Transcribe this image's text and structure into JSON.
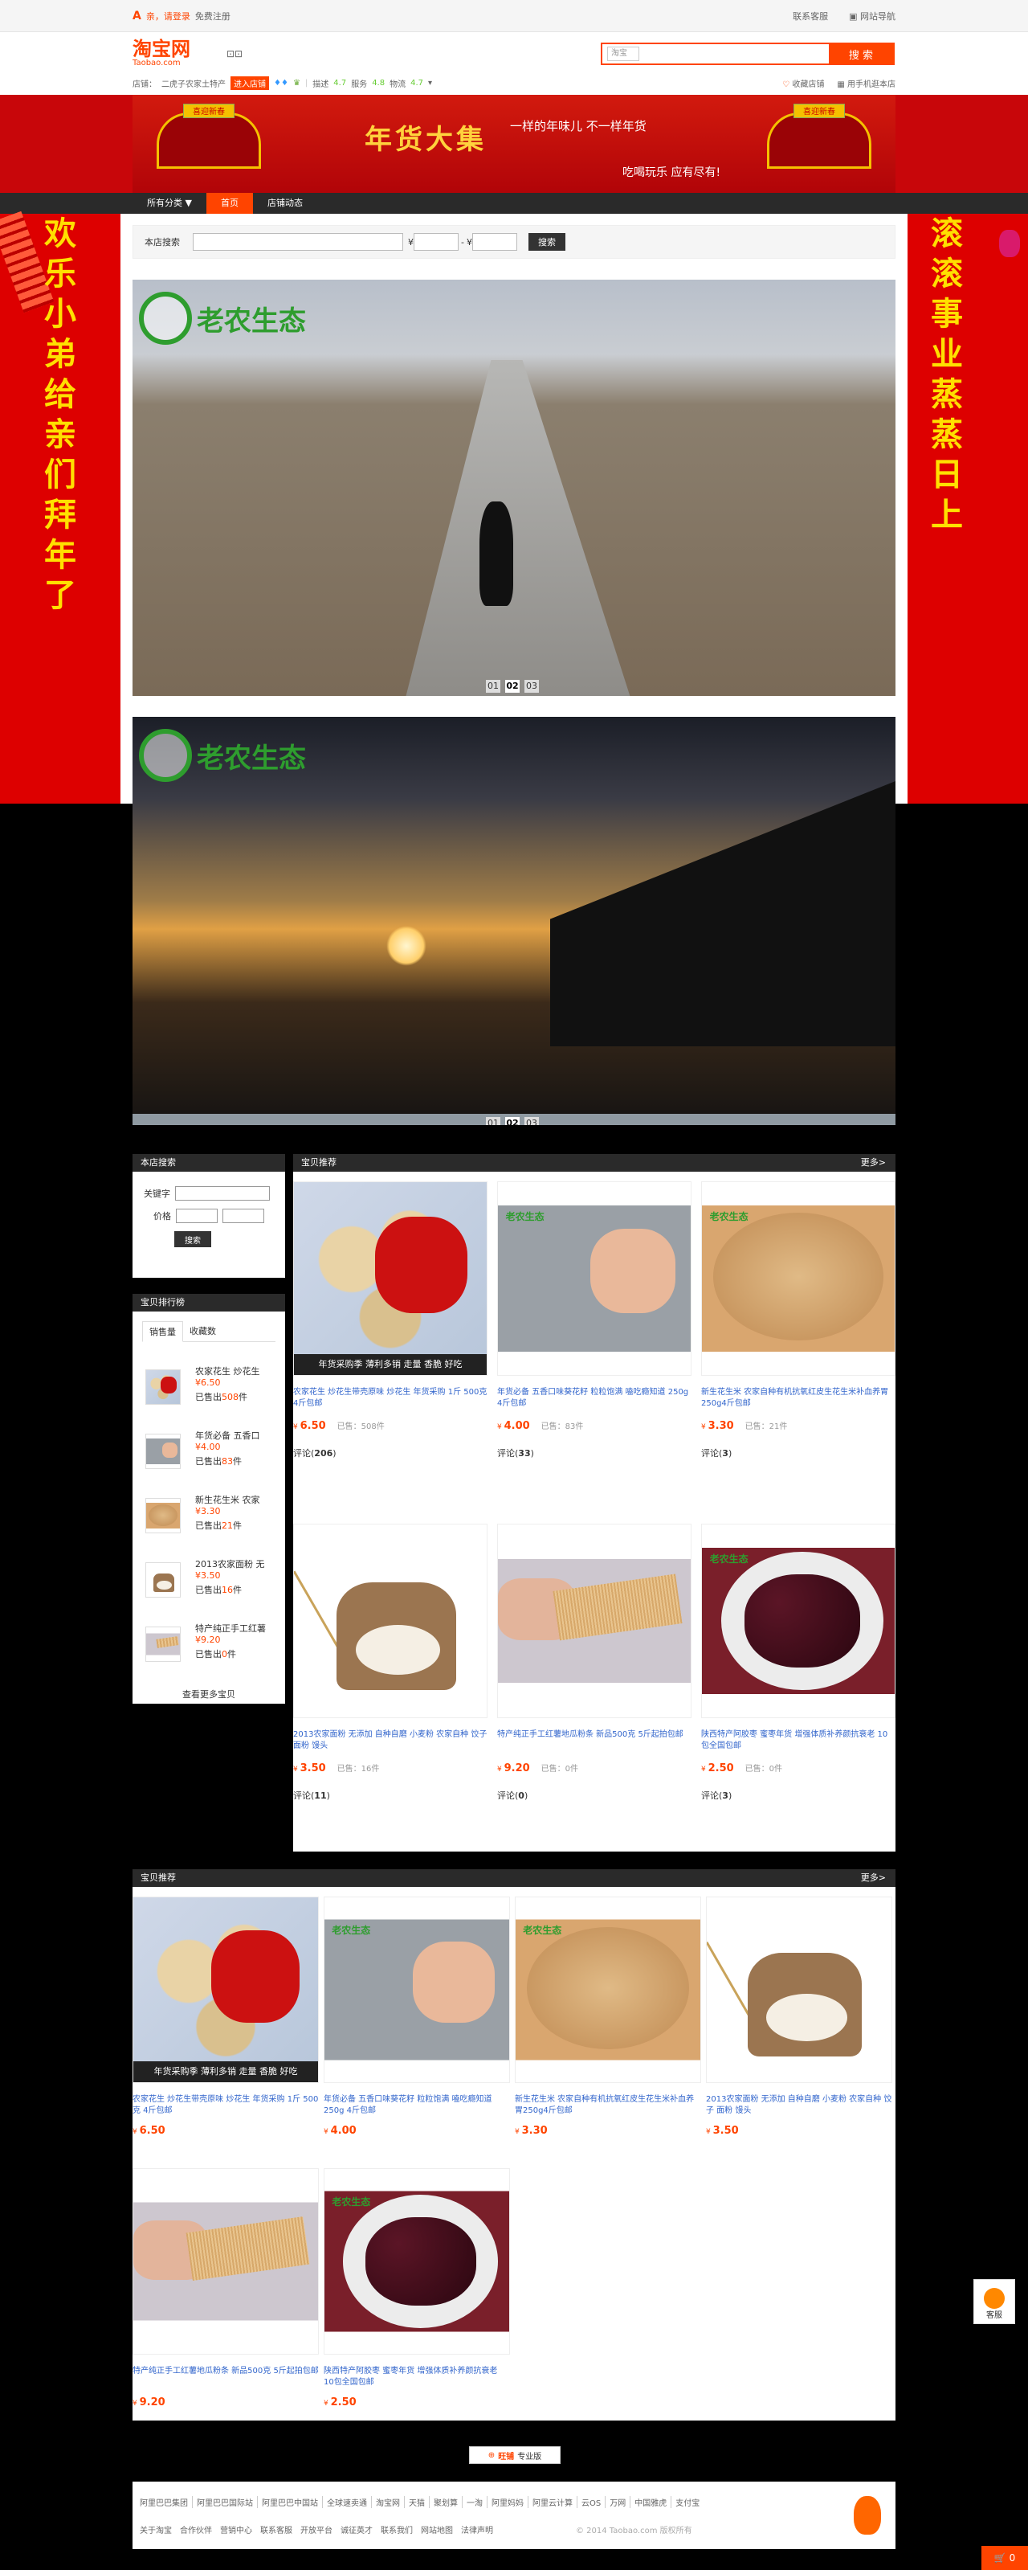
{
  "topbar": {
    "greeting": "亲，请登录",
    "register": "免费注册",
    "contact": "联系客服",
    "sitenav": "网站导航"
  },
  "header": {
    "logo_cn": "淘宝网",
    "logo_en": "Taobao.com",
    "search_scope": "淘宝",
    "search_placeholder": "",
    "search_button": "搜 索",
    "shop_label": "店铺：",
    "shop_name": "二虎子农家土特产",
    "enter_shop": "进入店铺",
    "desc_label": "描述",
    "desc_score": "4.7",
    "service_label": "服务",
    "service_score": "4.8",
    "logistics_label": "物流",
    "logistics_score": "4.7",
    "fav_shop": "收藏店铺",
    "mobile_shop": "用手机逛本店"
  },
  "banner": {
    "title": "年货大集",
    "sub1": "一样的年味儿 不一样年货",
    "sub2": "吃喝玩乐 应有尽有!",
    "gate_left": "喜迎新春",
    "gate_right": "喜迎新春"
  },
  "nav": {
    "all_categories": "所有分类 ▼",
    "home": "首页",
    "shop_news": "店铺动态"
  },
  "side": {
    "left_text": [
      "欢乐小弟给亲们拜年了"
    ],
    "right_text": [
      "滚滚事业蒸蒸日上"
    ]
  },
  "store_search": {
    "label": "本店搜索",
    "currency": "¥",
    "dash": "-",
    "button": "搜索"
  },
  "brand": {
    "name": "老农生态"
  },
  "slider1": {
    "pages": [
      "01",
      "02",
      "03"
    ],
    "current": "02"
  },
  "slider2": {
    "pages": [
      "01",
      "02",
      "03"
    ],
    "current": "02"
  },
  "left_search": {
    "title": "本店搜索",
    "keyword_label": "关键字",
    "price_label": "价格",
    "currency": "¥",
    "button": "搜索"
  },
  "rank": {
    "title": "宝贝排行榜",
    "tab_sales": "销售量",
    "tab_fav": "收藏数",
    "sold_prefix": "已售出",
    "sold_suffix": "件",
    "items": [
      {
        "name": "农家花生 炒花生",
        "price": "¥6.50",
        "sold": "508"
      },
      {
        "name": "年货必备 五香口",
        "price": "¥4.00",
        "sold": "83"
      },
      {
        "name": "新生花生米 农家",
        "price": "¥3.30",
        "sold": "21"
      },
      {
        "name": "2013农家面粉 无",
        "price": "¥3.50",
        "sold": "16"
      },
      {
        "name": "特产纯正手工红薯",
        "price": "¥9.20",
        "sold": "0"
      }
    ],
    "more": "查看更多宝贝"
  },
  "recommend": {
    "title": "宝贝推荐",
    "more": "更多>",
    "sold_label": "已售：",
    "comment_label": "评论",
    "caption": "年货采购季 薄利多销 走量 香脆 好吃",
    "items": [
      {
        "name": "农家花生 炒花生带壳原味 炒花生 年货采购 1斤 500克 4斤包邮",
        "price": "6.50",
        "sold": "508件",
        "comments": "206"
      },
      {
        "name": "年货必备 五香口味葵花籽 粒粒饱满 嗑吃瘾知道 250g 4斤包邮",
        "price": "4.00",
        "sold": "83件",
        "comments": "33"
      },
      {
        "name": "新生花生米 农家自种有机抗氧红皮生花生米补血养胃250g4斤包邮",
        "price": "3.30",
        "sold": "21件",
        "comments": "3"
      },
      {
        "name": "2013农家面粉 无添加 自种自磨 小麦粉 农家自种 饺子 面粉 馒头",
        "price": "3.50",
        "sold": "16件",
        "comments": "11"
      },
      {
        "name": "特产纯正手工红薯地瓜粉条 新品500克 5斤起拍包邮",
        "price": "9.20",
        "sold": "0件",
        "comments": "0"
      },
      {
        "name": "陕西特产阿胶枣 蜜枣年货 增强体质补养颜抗衰老 10包全国包邮",
        "price": "2.50",
        "sold": "0件",
        "comments": "3"
      }
    ]
  },
  "recommend2": {
    "title": "宝贝推荐",
    "more": "更多>",
    "items": [
      {
        "name": "农家花生 炒花生带壳原味 炒花生 年货采购 1斤 500克 4斤包邮",
        "price": "6.50"
      },
      {
        "name": "年货必备 五香口味葵花籽 粒粒饱满 嗑吃瘾知道 250g 4斤包邮",
        "price": "4.00"
      },
      {
        "name": "新生花生米 农家自种有机抗氧红皮生花生米补血养胃250g4斤包邮",
        "price": "3.30"
      },
      {
        "name": "2013农家面粉 无添加 自种自磨 小麦粉 农家自种 饺子 面粉 馒头",
        "price": "3.50"
      },
      {
        "name": "特产纯正手工红薯地瓜粉条 新品500克 5斤起拍包邮",
        "price": "9.20"
      },
      {
        "name": "陕西特产阿胶枣 蜜枣年货 增强体质补养颜抗衰老 10包全国包邮",
        "price": "2.50"
      }
    ]
  },
  "wangpu": {
    "brand": "旺铺",
    "tag": "专业版"
  },
  "footer": {
    "links": [
      "阿里巴巴集团",
      "阿里巴巴国际站",
      "阿里巴巴中国站",
      "全球速卖通",
      "淘宝网",
      "天猫",
      "聚划算",
      "一淘",
      "阿里妈妈",
      "阿里云计算",
      "云OS",
      "万网",
      "中国雅虎",
      "支付宝"
    ],
    "links2": [
      "关于淘宝",
      "合作伙伴",
      "营销中心",
      "联系客服",
      "开放平台",
      "诚征英才",
      "联系我们",
      "网站地图",
      "法律声明"
    ],
    "copyright": "© 2014 Taobao.com 版权所有"
  },
  "service_label": "客服",
  "cart_count": "0",
  "colors": {
    "accent": "#ff4400",
    "banner_red": "#c8060a",
    "nav_dark": "#2a2a2a",
    "gold": "#ffd23d"
  }
}
